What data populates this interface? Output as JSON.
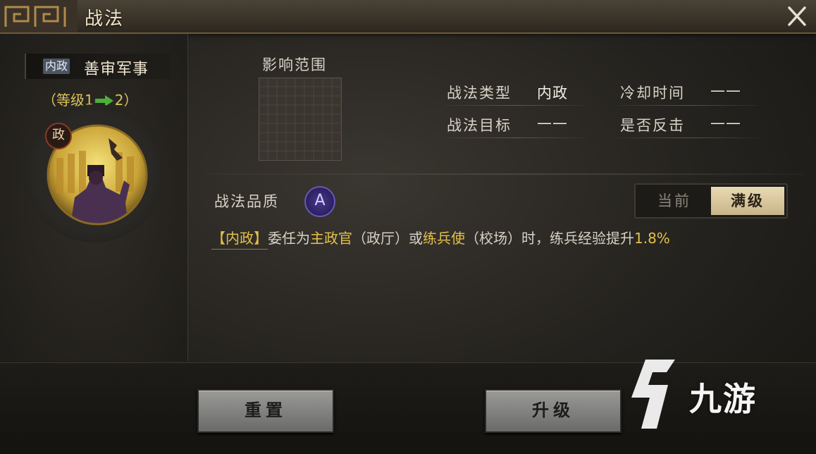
{
  "window": {
    "title": "战法"
  },
  "skill": {
    "type_tag": "内政",
    "name": "善审军事",
    "level_open": "（等级1",
    "level_close": "2）",
    "badge": "政"
  },
  "range": {
    "label": "影响范围"
  },
  "stats": {
    "type_label": "战法类型",
    "type_value": "内政",
    "cooldown_label": "冷却时间",
    "cooldown_value": "——",
    "target_label": "战法目标",
    "target_value": "——",
    "counter_label": "是否反击",
    "counter_value": "——"
  },
  "quality": {
    "label": "战法品质",
    "grade": "A"
  },
  "toggle": {
    "current": "当前",
    "max": "满级"
  },
  "description": {
    "tag": "【内政】",
    "p1": "委任为",
    "h1": "主政官",
    "p2": "（政厅）或",
    "h2": "练兵使",
    "p3": "（校场）时，练兵经验提升",
    "value": "1.8%"
  },
  "buttons": {
    "reset": "重置",
    "upgrade": "升级"
  },
  "watermark": {
    "text": "九游"
  },
  "colors": {
    "highlight": "#e4c04a",
    "quality": "#6a58b8",
    "level": "#d9c45a"
  }
}
